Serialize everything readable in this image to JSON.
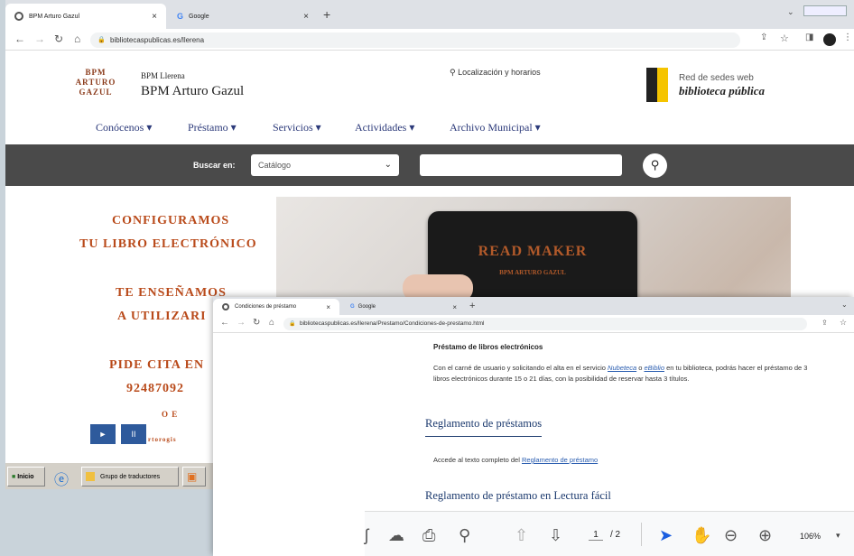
{
  "win1": {
    "tabs": [
      {
        "title": "BPM Arturo Gazul",
        "close": "×"
      },
      {
        "title": "Google",
        "close": "×"
      }
    ],
    "new_tab": "+",
    "url": "bibliotecaspublicas.es/llerena",
    "site": {
      "logo_text": "BPM ARTURO GAZUL",
      "subtitle": "BPM Llerena",
      "title": "BPM Arturo Gazul",
      "location_link": "Localización y horarios",
      "brand_top": "Red de sedes web",
      "brand_bottom": "biblioteca pública",
      "nav": [
        "Conócenos ▾",
        "Préstamo ▾",
        "Servicios ▾",
        "Actividades ▾",
        "Archivo Municipal ▾"
      ],
      "search_label": "Buscar en:",
      "search_select": "Catálogo",
      "search_value": ""
    },
    "promo": {
      "line1": "CONFIGURAMOS",
      "line2": "TU LIBRO ELECTRÓNICO",
      "line3": "TE ENSEÑAMOS",
      "line4": "A UTILIZARI",
      "line5": "PIDE CITA EN",
      "line6": "92487092",
      "line7": "O E",
      "line8": "rtorogis",
      "ereader_text": "READ MAKER",
      "ereader_logo": "BPM ARTURO GAZUL",
      "play": "►",
      "pause": "II"
    }
  },
  "taskbar": {
    "start": "Inicio",
    "folder": "Grupo de traductores"
  },
  "win2": {
    "tabs": [
      {
        "title": "Condiciones de préstamo",
        "close": "×"
      },
      {
        "title": "Google",
        "close": "×"
      }
    ],
    "new_tab": "+",
    "url": "bibliotecaspublicas.es/llerena/Prestamo/Condiciones-de-prestamo.html",
    "heading_small": "Préstamo de libros electrónicos",
    "para_before": "Con el carné de usuario y solicitando el alta en el servicio ",
    "link_nubeteca": "Nubeteca",
    "para_o": " o ",
    "link_ebiblio": "eBiblio",
    "para_after": " en tu biblioteca, podrás hacer el préstamo de 3 libros electrónicos durante 15 o 21 días, con la posibilidad de reservar hasta 3 títulos.",
    "section1": "Reglamento de préstamos",
    "access_text": "Accede al texto completo del ",
    "access_link": "Reglamento de préstamo",
    "section2": "Reglamento de préstamo en Lectura fácil"
  },
  "pdf": {
    "page_current": "1",
    "page_total": "/ 2",
    "zoom": "106%"
  }
}
